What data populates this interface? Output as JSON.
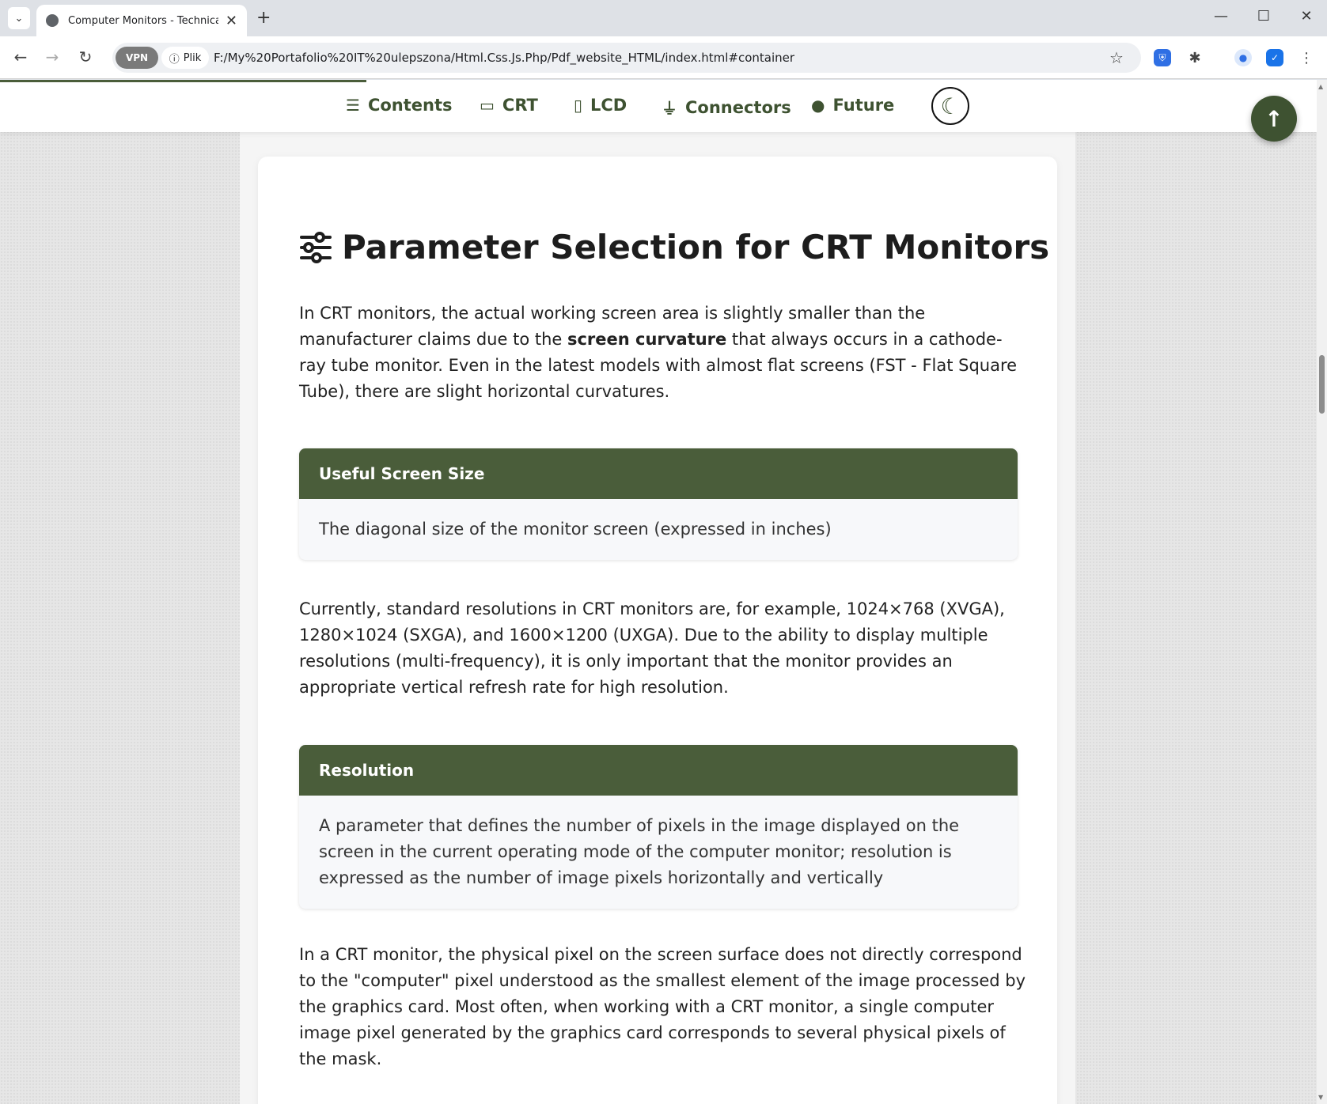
{
  "browser": {
    "tab_title": "Computer Monitors - Technical Ov",
    "vpn_label": "VPN",
    "file_label": "Plik",
    "url": "F:/My%20Portafolio%20IT%20ulepszona/Html.Css.Js.Php/Pdf_website_HTML/index.html#container"
  },
  "nav": {
    "items": [
      {
        "label": "Contents",
        "icon": "list-icon"
      },
      {
        "label": "CRT",
        "icon": "desktop-icon"
      },
      {
        "label": "LCD",
        "icon": "tablet-icon"
      },
      {
        "label": "Connectors",
        "icon": "plug-icon"
      },
      {
        "label": "Future",
        "icon": "lightbulb-icon"
      }
    ],
    "scroll_progress": 0.278
  },
  "section": {
    "title": "Parameter Selection for CRT Monitors",
    "intro_before": "In CRT monitors, the actual working screen area is slightly smaller than the manufacturer claims due to the ",
    "intro_bold": "screen curvature",
    "intro_after": " that always occurs in a cathode-ray tube monitor. Even in the latest models with almost flat screens (FST - Flat Square Tube), there are slight horizontal curvatures.",
    "box1": {
      "title": "Useful Screen Size",
      "text": "The diagonal size of the monitor screen (expressed in inches)"
    },
    "para2": "Currently, standard resolutions in CRT monitors are, for example, 1024×768 (XVGA), 1280×1024 (SXGA), and 1600×1200 (UXGA). Due to the ability to display multiple resolutions (multi-frequency), it is only important that the monitor provides an appropriate vertical refresh rate for high resolution.",
    "box2": {
      "title": "Resolution",
      "text": "A parameter that defines the number of pixels in the image displayed on the screen in the current operating mode of the computer monitor; resolution is expressed as the number of image pixels horizontally and vertically"
    },
    "para3": "In a CRT monitor, the physical pixel on the screen surface does not directly correspond to the \"computer\" pixel understood as the smallest element of the image processed by the graphics card. Most often, when working with a CRT monitor, a single computer image pixel generated by the graphics card corresponds to several physical pixels of the mask."
  },
  "colors": {
    "accent": "#4a5d3a",
    "nav_text": "#3e5231"
  }
}
